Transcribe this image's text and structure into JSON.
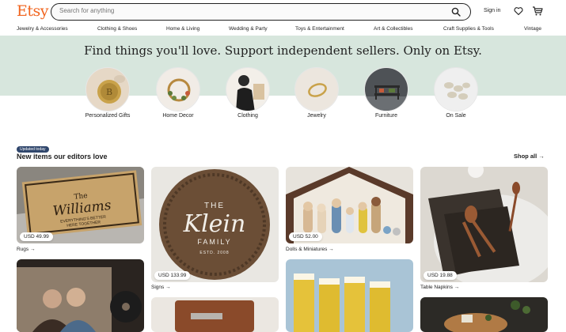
{
  "header": {
    "logo": "Etsy",
    "search_placeholder": "Search for anything",
    "sign_in": "Sign in",
    "icons": [
      "search-icon",
      "heart-icon",
      "cart-icon"
    ]
  },
  "nav": {
    "items": [
      "Jewelry & Accessories",
      "Clothing & Shoes",
      "Home & Living",
      "Wedding & Party",
      "Toys & Entertainment",
      "Art & Collectibles",
      "Craft Supplies & Tools",
      "Vintage"
    ]
  },
  "banner": {
    "title": "Find things you'll love. Support independent sellers. Only on Etsy."
  },
  "categories": [
    {
      "label": "Personalized Gifts"
    },
    {
      "label": "Home Decor"
    },
    {
      "label": "Clothing"
    },
    {
      "label": "Jewelry"
    },
    {
      "label": "Furniture"
    },
    {
      "label": "On Sale"
    }
  ],
  "editors": {
    "badge": "Updated today",
    "title": "New items our editors love",
    "shop_all": "Shop all →"
  },
  "cards": [
    {
      "price": "USD 49.99",
      "caption": "Rugs →",
      "image_text": [
        "The",
        "Williams",
        "EVERYTHING'S BETTER",
        "HERE TOGETHER"
      ]
    },
    {
      "price": "USD 133.99",
      "caption": "Signs →",
      "image_text": [
        "THE",
        "Klein",
        "FAMILY",
        "ESTD. 2008"
      ]
    },
    {
      "price": "USD 52.00",
      "caption": "Dolls & Miniatures →"
    },
    {
      "price": "USD 19.88",
      "caption": "Table Napkins →"
    }
  ],
  "colors": {
    "brand": "#f1641e",
    "banner_bg": "#d7e6dd",
    "badge_bg": "#2f466c"
  }
}
